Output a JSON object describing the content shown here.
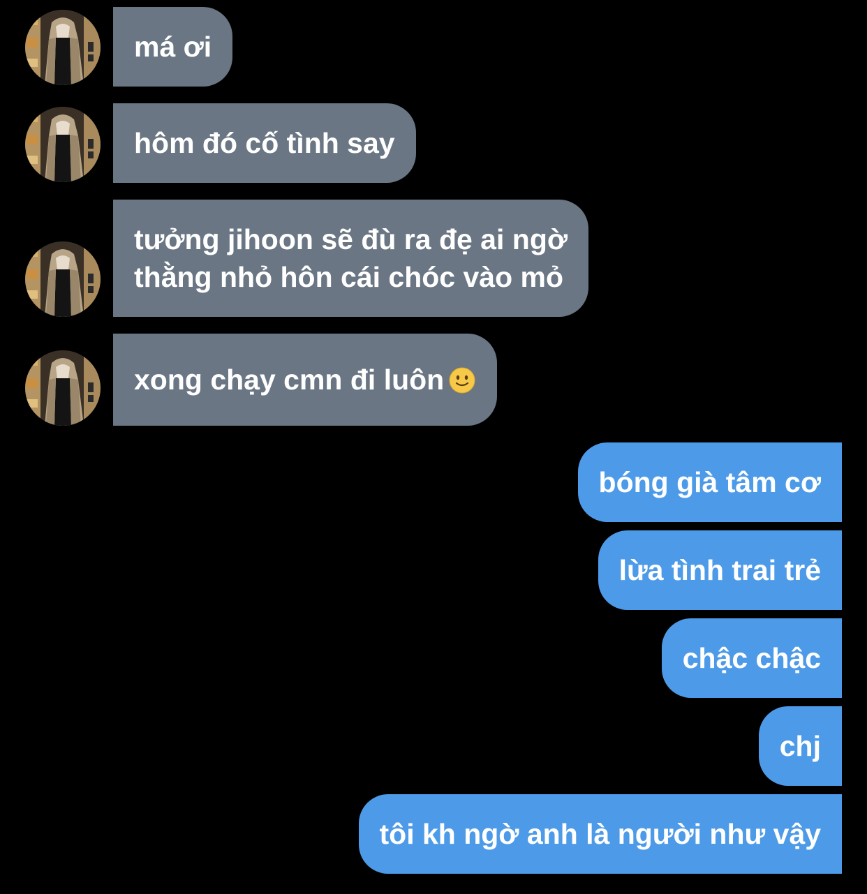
{
  "conversation": {
    "incoming": [
      {
        "text": "má ơi"
      },
      {
        "text": "hôm đó cố tình say"
      },
      {
        "line1": "tưởng jihoon sẽ đù ra đẹ ai ngờ",
        "line2": "thằng nhỏ hôn cái chóc vào mỏ"
      },
      {
        "text": "xong chạy cmn đi luôn",
        "emoji": "slightly-smiling-face-icon"
      }
    ],
    "outgoing": [
      {
        "text": "bóng già tâm cơ"
      },
      {
        "text": "lừa tình trai trẻ"
      },
      {
        "text": "chậc chậc"
      },
      {
        "text": "chj"
      },
      {
        "text": "tôi kh ngờ anh là người như vậy"
      }
    ]
  },
  "colors": {
    "background": "#000000",
    "incoming_bubble": "#6a7683",
    "outgoing_bubble": "#4d9be8",
    "text": "#ffffff"
  }
}
